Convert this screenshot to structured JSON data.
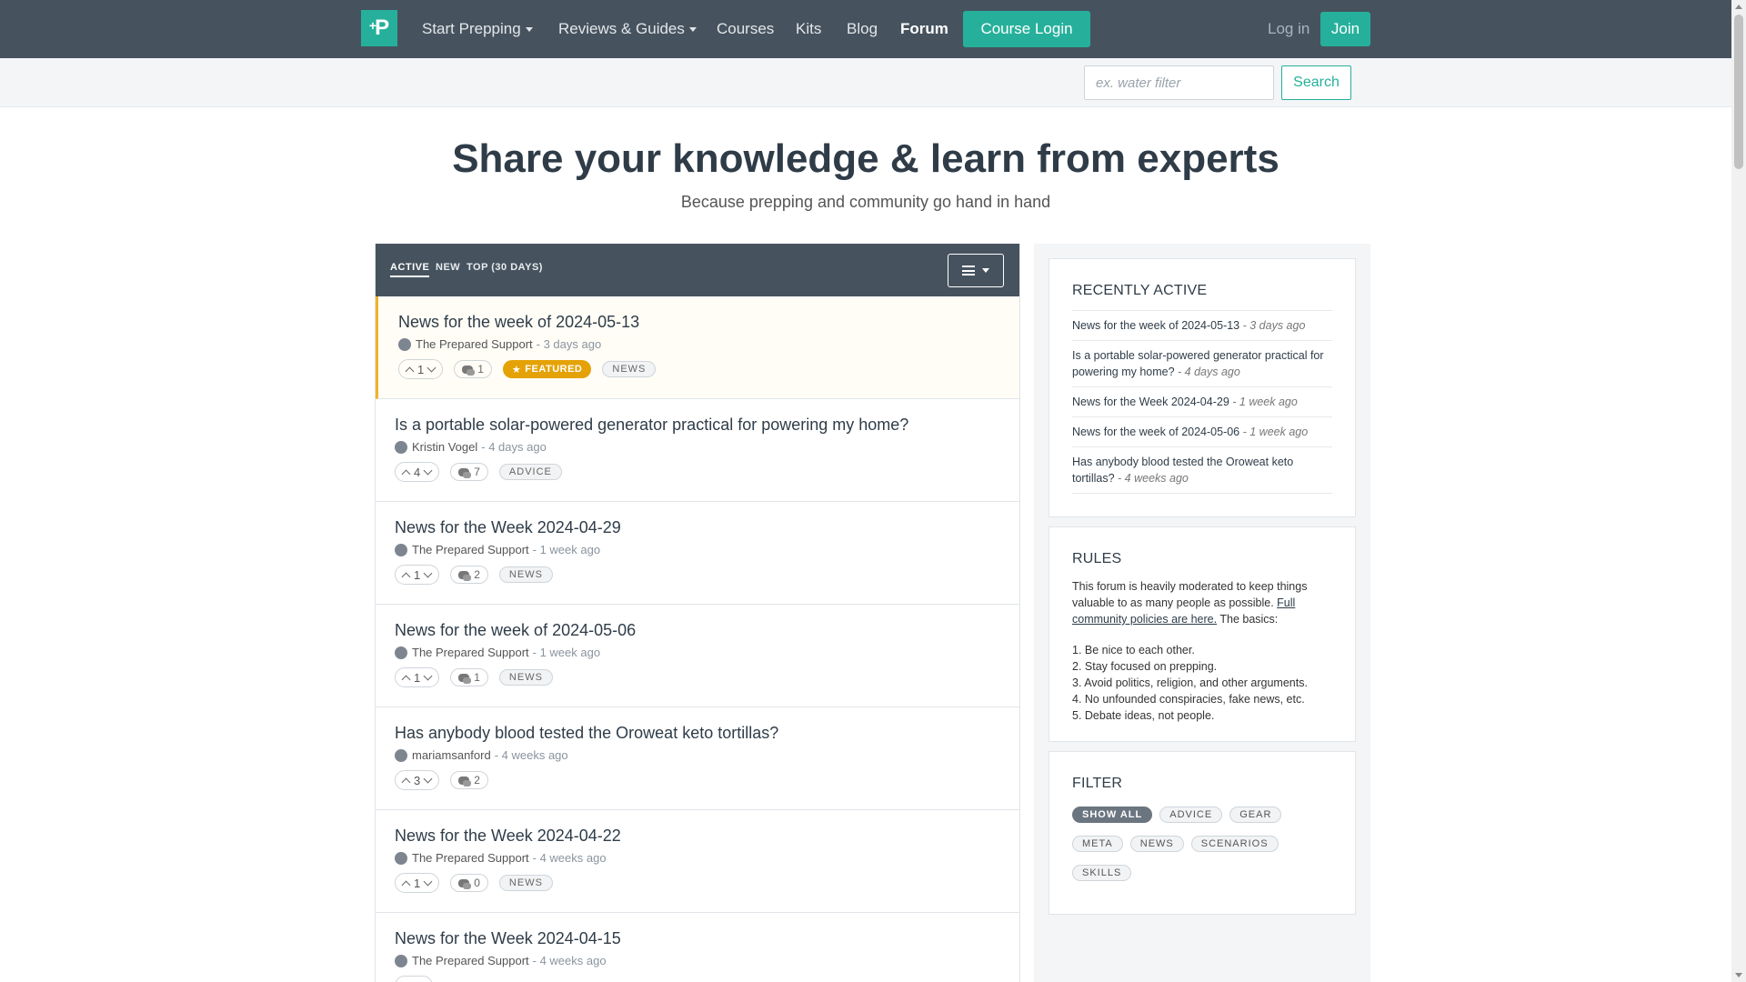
{
  "nav": {
    "logo_text": "P",
    "items": [
      {
        "label": "Start Prepping",
        "dropdown": true
      },
      {
        "label": "Reviews & Guides",
        "dropdown": true
      },
      {
        "label": "Courses"
      },
      {
        "label": "Kits"
      },
      {
        "label": "Blog"
      },
      {
        "label": "Forum",
        "active": true
      }
    ],
    "course_login": "Course Login",
    "login": "Log in",
    "join": "Join"
  },
  "search": {
    "placeholder": "ex. water filter",
    "button": "Search"
  },
  "hero": {
    "title": "Share your knowledge & learn from experts",
    "subtitle": "Because prepping and community go hand in hand"
  },
  "feed": {
    "tabs": [
      "ACTIVE",
      "NEW",
      "TOP (30 DAYS)"
    ],
    "posts": [
      {
        "title": "News for the week of 2024-05-13",
        "author": "The Prepared Support",
        "time": "- 3 days ago",
        "votes": "1",
        "comments": "1",
        "featured": "FEATURED",
        "tags": [
          "NEWS"
        ]
      },
      {
        "title": "Is a portable solar-powered generator practical for powering my home?",
        "author": "Kristin Vogel",
        "time": "- 4 days ago",
        "votes": "4",
        "comments": "7",
        "tags": [
          "ADVICE"
        ]
      },
      {
        "title": "News for the Week 2024-04-29",
        "author": "The Prepared Support",
        "time": "- 1 week ago",
        "votes": "1",
        "comments": "2",
        "tags": [
          "NEWS"
        ]
      },
      {
        "title": "News for the week of 2024-05-06",
        "author": "The Prepared Support",
        "time": "- 1 week ago",
        "votes": "1",
        "comments": "1",
        "tags": [
          "NEWS"
        ]
      },
      {
        "title": "Has anybody blood tested the Oroweat keto tortillas?",
        "author": "mariamsanford",
        "time": "- 4 weeks ago",
        "votes": "3",
        "comments": "2",
        "tags": []
      },
      {
        "title": "News for the Week 2024-04-22",
        "author": "The Prepared Support",
        "time": "- 4 weeks ago",
        "votes": "1",
        "comments": "0",
        "tags": [
          "NEWS"
        ]
      },
      {
        "title": "News for the Week 2024-04-15",
        "author": "The Prepared Support",
        "time": "- 4 weeks ago",
        "votes": "",
        "comments": "",
        "tags": []
      }
    ]
  },
  "sidebar": {
    "recent": {
      "title": "RECENTLY ACTIVE",
      "items": [
        {
          "title": "News for the week of 2024-05-13",
          "time": "- 3 days ago"
        },
        {
          "title": "Is a portable solar-powered generator practical for powering my home?",
          "time": "- 4 days ago"
        },
        {
          "title": "News for the Week 2024-04-29",
          "time": "- 1 week ago"
        },
        {
          "title": "News for the week of 2024-05-06",
          "time": "- 1 week ago"
        },
        {
          "title": "Has anybody blood tested the Oroweat keto tortillas?",
          "time": "- 4 weeks ago"
        }
      ]
    },
    "rules": {
      "title": "RULES",
      "intro": "This forum is heavily moderated to keep things valuable to as many people as possible.",
      "link": "Full community policies are here.",
      "after": "The basics:",
      "list": [
        "1. Be nice to each other.",
        "2. Stay focused on prepping.",
        "3. Avoid politics, religion, and other arguments.",
        "4. No unfounded conspiracies, fake news, etc.",
        "5. Debate ideas, not people."
      ]
    },
    "filter": {
      "title": "FILTER",
      "tags": [
        "SHOW ALL",
        "ADVICE",
        "GEAR",
        "META",
        "NEWS",
        "SCENARIOS",
        "SKILLS"
      ]
    }
  },
  "colors": {
    "nav_bg": "#46535f",
    "accent": "#26b09b",
    "featured": "#e5a206"
  }
}
